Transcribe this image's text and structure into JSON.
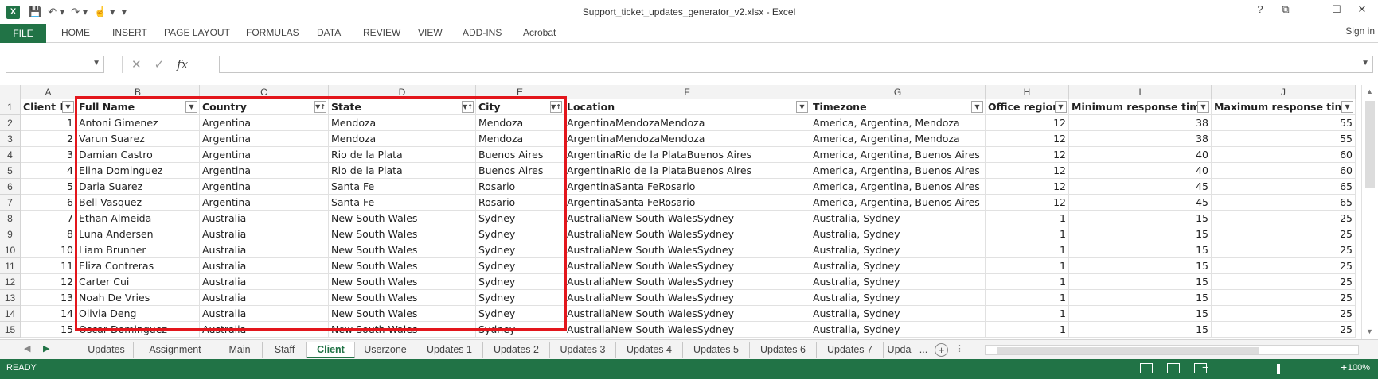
{
  "window": {
    "title": "Support_ticket_updates_generator_v2.xlsx - Excel",
    "controls": [
      "?",
      "⧉",
      "—",
      "☐",
      "✕"
    ]
  },
  "quick_access": {
    "icons": [
      "save-icon",
      "undo-icon",
      "redo-icon",
      "touch-mode-icon",
      "customize-icon"
    ]
  },
  "ribbon": {
    "file_label": "FILE",
    "tabs": [
      "HOME",
      "INSERT",
      "PAGE LAYOUT",
      "FORMULAS",
      "DATA",
      "REVIEW",
      "VIEW",
      "ADD-INS",
      "Acrobat"
    ],
    "signin": "Sign in"
  },
  "formula_bar": {
    "name_box": "",
    "formula": "",
    "fx_label": "fx"
  },
  "grid": {
    "columns": [
      "A",
      "B",
      "C",
      "D",
      "E",
      "F",
      "G",
      "H",
      "I",
      "J"
    ],
    "rows": [
      "1",
      "2",
      "3",
      "4",
      "5",
      "6",
      "7",
      "8",
      "9",
      "10",
      "11",
      "12",
      "13",
      "14",
      "15"
    ],
    "headers": [
      "Client ID",
      "Full Name",
      "Country",
      "State",
      "City",
      "Location",
      "Timezone",
      "Office region",
      "Minimum response time",
      "Maximum response time"
    ],
    "data": [
      [
        "1",
        "Antoni Gimenez",
        "Argentina",
        "Mendoza",
        "Mendoza",
        "ArgentinaMendozaMendoza",
        "America, Argentina, Mendoza",
        "12",
        "38",
        "55"
      ],
      [
        "2",
        "Varun Suarez",
        "Argentina",
        "Mendoza",
        "Mendoza",
        "ArgentinaMendozaMendoza",
        "America, Argentina, Mendoza",
        "12",
        "38",
        "55"
      ],
      [
        "3",
        "Damian Castro",
        "Argentina",
        "Rio de la Plata",
        "Buenos Aires",
        "ArgentinaRio de la PlataBuenos Aires",
        "America, Argentina, Buenos Aires",
        "12",
        "40",
        "60"
      ],
      [
        "4",
        "Elina Dominguez",
        "Argentina",
        "Rio de la Plata",
        "Buenos Aires",
        "ArgentinaRio de la PlataBuenos Aires",
        "America, Argentina, Buenos Aires",
        "12",
        "40",
        "60"
      ],
      [
        "5",
        "Daria Suarez",
        "Argentina",
        "Santa Fe",
        "Rosario",
        "ArgentinaSanta FeRosario",
        "America, Argentina, Buenos Aires",
        "12",
        "45",
        "65"
      ],
      [
        "6",
        "Bell Vasquez",
        "Argentina",
        "Santa Fe",
        "Rosario",
        "ArgentinaSanta FeRosario",
        "America, Argentina, Buenos Aires",
        "12",
        "45",
        "65"
      ],
      [
        "7",
        "Ethan Almeida",
        "Australia",
        "New South Wales",
        "Sydney",
        "AustraliaNew South WalesSydney",
        "Australia, Sydney",
        "1",
        "15",
        "25"
      ],
      [
        "8",
        "Luna Andersen",
        "Australia",
        "New South Wales",
        "Sydney",
        "AustraliaNew South WalesSydney",
        "Australia, Sydney",
        "1",
        "15",
        "25"
      ],
      [
        "10",
        "Liam Brunner",
        "Australia",
        "New South Wales",
        "Sydney",
        "AustraliaNew South WalesSydney",
        "Australia, Sydney",
        "1",
        "15",
        "25"
      ],
      [
        "11",
        "Eliza Contreras",
        "Australia",
        "New South Wales",
        "Sydney",
        "AustraliaNew South WalesSydney",
        "Australia, Sydney",
        "1",
        "15",
        "25"
      ],
      [
        "12",
        "Carter Cui",
        "Australia",
        "New South Wales",
        "Sydney",
        "AustraliaNew South WalesSydney",
        "Australia, Sydney",
        "1",
        "15",
        "25"
      ],
      [
        "13",
        "Noah De Vries",
        "Australia",
        "New South Wales",
        "Sydney",
        "AustraliaNew South WalesSydney",
        "Australia, Sydney",
        "1",
        "15",
        "25"
      ],
      [
        "14",
        "Olivia Deng",
        "Australia",
        "New South Wales",
        "Sydney",
        "AustraliaNew South WalesSydney",
        "Australia, Sydney",
        "1",
        "15",
        "25"
      ],
      [
        "15",
        "Oscar Dominguez",
        "Australia",
        "New South Wales",
        "Sydney",
        "AustraliaNew South WalesSydney",
        "Australia, Sydney",
        "1",
        "15",
        "25"
      ]
    ]
  },
  "sheets": {
    "tabs": [
      "Updates",
      "Assignment",
      "Main",
      "Staff",
      "Client",
      "Userzone",
      "Updates 1",
      "Updates 2",
      "Updates 3",
      "Updates 4",
      "Updates 5",
      "Updates 6",
      "Updates 7",
      "Upda"
    ],
    "active": "Client",
    "more": "..."
  },
  "status": {
    "mode": "READY",
    "zoom": "100%"
  },
  "colors": {
    "accent": "#217346",
    "highlight": "#e3161c"
  }
}
